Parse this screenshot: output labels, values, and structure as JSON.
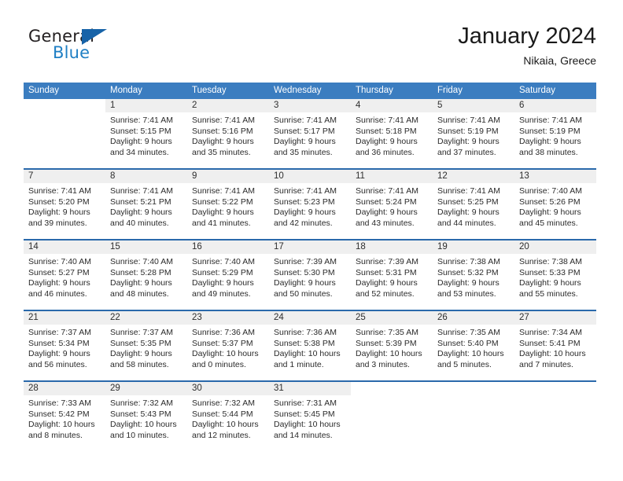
{
  "brand": {
    "name_top": "General",
    "name_bottom": "Blue",
    "accent_color": "#1763a8",
    "text_color": "#231f20",
    "blue_text_color": "#1f7fc4"
  },
  "header": {
    "title": "January 2024",
    "location": "Nikaia, Greece"
  },
  "theme": {
    "header_blue": "#3b7dc0",
    "row_divider_blue": "#2a69ab",
    "daynum_band_gray": "#efefef"
  },
  "weekdays": [
    "Sunday",
    "Monday",
    "Tuesday",
    "Wednesday",
    "Thursday",
    "Friday",
    "Saturday"
  ],
  "weeks": [
    [
      {
        "day": "",
        "lines": [],
        "filled": false
      },
      {
        "day": "1",
        "lines": [
          "Sunrise: 7:41 AM",
          "Sunset: 5:15 PM",
          "Daylight: 9 hours",
          "and 34 minutes."
        ],
        "filled": true
      },
      {
        "day": "2",
        "lines": [
          "Sunrise: 7:41 AM",
          "Sunset: 5:16 PM",
          "Daylight: 9 hours",
          "and 35 minutes."
        ],
        "filled": true
      },
      {
        "day": "3",
        "lines": [
          "Sunrise: 7:41 AM",
          "Sunset: 5:17 PM",
          "Daylight: 9 hours",
          "and 35 minutes."
        ],
        "filled": true
      },
      {
        "day": "4",
        "lines": [
          "Sunrise: 7:41 AM",
          "Sunset: 5:18 PM",
          "Daylight: 9 hours",
          "and 36 minutes."
        ],
        "filled": true
      },
      {
        "day": "5",
        "lines": [
          "Sunrise: 7:41 AM",
          "Sunset: 5:19 PM",
          "Daylight: 9 hours",
          "and 37 minutes."
        ],
        "filled": true
      },
      {
        "day": "6",
        "lines": [
          "Sunrise: 7:41 AM",
          "Sunset: 5:19 PM",
          "Daylight: 9 hours",
          "and 38 minutes."
        ],
        "filled": true
      }
    ],
    [
      {
        "day": "7",
        "lines": [
          "Sunrise: 7:41 AM",
          "Sunset: 5:20 PM",
          "Daylight: 9 hours",
          "and 39 minutes."
        ],
        "filled": true
      },
      {
        "day": "8",
        "lines": [
          "Sunrise: 7:41 AM",
          "Sunset: 5:21 PM",
          "Daylight: 9 hours",
          "and 40 minutes."
        ],
        "filled": true
      },
      {
        "day": "9",
        "lines": [
          "Sunrise: 7:41 AM",
          "Sunset: 5:22 PM",
          "Daylight: 9 hours",
          "and 41 minutes."
        ],
        "filled": true
      },
      {
        "day": "10",
        "lines": [
          "Sunrise: 7:41 AM",
          "Sunset: 5:23 PM",
          "Daylight: 9 hours",
          "and 42 minutes."
        ],
        "filled": true
      },
      {
        "day": "11",
        "lines": [
          "Sunrise: 7:41 AM",
          "Sunset: 5:24 PM",
          "Daylight: 9 hours",
          "and 43 minutes."
        ],
        "filled": true
      },
      {
        "day": "12",
        "lines": [
          "Sunrise: 7:41 AM",
          "Sunset: 5:25 PM",
          "Daylight: 9 hours",
          "and 44 minutes."
        ],
        "filled": true
      },
      {
        "day": "13",
        "lines": [
          "Sunrise: 7:40 AM",
          "Sunset: 5:26 PM",
          "Daylight: 9 hours",
          "and 45 minutes."
        ],
        "filled": true
      }
    ],
    [
      {
        "day": "14",
        "lines": [
          "Sunrise: 7:40 AM",
          "Sunset: 5:27 PM",
          "Daylight: 9 hours",
          "and 46 minutes."
        ],
        "filled": true
      },
      {
        "day": "15",
        "lines": [
          "Sunrise: 7:40 AM",
          "Sunset: 5:28 PM",
          "Daylight: 9 hours",
          "and 48 minutes."
        ],
        "filled": true
      },
      {
        "day": "16",
        "lines": [
          "Sunrise: 7:40 AM",
          "Sunset: 5:29 PM",
          "Daylight: 9 hours",
          "and 49 minutes."
        ],
        "filled": true
      },
      {
        "day": "17",
        "lines": [
          "Sunrise: 7:39 AM",
          "Sunset: 5:30 PM",
          "Daylight: 9 hours",
          "and 50 minutes."
        ],
        "filled": true
      },
      {
        "day": "18",
        "lines": [
          "Sunrise: 7:39 AM",
          "Sunset: 5:31 PM",
          "Daylight: 9 hours",
          "and 52 minutes."
        ],
        "filled": true
      },
      {
        "day": "19",
        "lines": [
          "Sunrise: 7:38 AM",
          "Sunset: 5:32 PM",
          "Daylight: 9 hours",
          "and 53 minutes."
        ],
        "filled": true
      },
      {
        "day": "20",
        "lines": [
          "Sunrise: 7:38 AM",
          "Sunset: 5:33 PM",
          "Daylight: 9 hours",
          "and 55 minutes."
        ],
        "filled": true
      }
    ],
    [
      {
        "day": "21",
        "lines": [
          "Sunrise: 7:37 AM",
          "Sunset: 5:34 PM",
          "Daylight: 9 hours",
          "and 56 minutes."
        ],
        "filled": true
      },
      {
        "day": "22",
        "lines": [
          "Sunrise: 7:37 AM",
          "Sunset: 5:35 PM",
          "Daylight: 9 hours",
          "and 58 minutes."
        ],
        "filled": true
      },
      {
        "day": "23",
        "lines": [
          "Sunrise: 7:36 AM",
          "Sunset: 5:37 PM",
          "Daylight: 10 hours",
          "and 0 minutes."
        ],
        "filled": true
      },
      {
        "day": "24",
        "lines": [
          "Sunrise: 7:36 AM",
          "Sunset: 5:38 PM",
          "Daylight: 10 hours",
          "and 1 minute."
        ],
        "filled": true
      },
      {
        "day": "25",
        "lines": [
          "Sunrise: 7:35 AM",
          "Sunset: 5:39 PM",
          "Daylight: 10 hours",
          "and 3 minutes."
        ],
        "filled": true
      },
      {
        "day": "26",
        "lines": [
          "Sunrise: 7:35 AM",
          "Sunset: 5:40 PM",
          "Daylight: 10 hours",
          "and 5 minutes."
        ],
        "filled": true
      },
      {
        "day": "27",
        "lines": [
          "Sunrise: 7:34 AM",
          "Sunset: 5:41 PM",
          "Daylight: 10 hours",
          "and 7 minutes."
        ],
        "filled": true
      }
    ],
    [
      {
        "day": "28",
        "lines": [
          "Sunrise: 7:33 AM",
          "Sunset: 5:42 PM",
          "Daylight: 10 hours",
          "and 8 minutes."
        ],
        "filled": true
      },
      {
        "day": "29",
        "lines": [
          "Sunrise: 7:32 AM",
          "Sunset: 5:43 PM",
          "Daylight: 10 hours",
          "and 10 minutes."
        ],
        "filled": true
      },
      {
        "day": "30",
        "lines": [
          "Sunrise: 7:32 AM",
          "Sunset: 5:44 PM",
          "Daylight: 10 hours",
          "and 12 minutes."
        ],
        "filled": true
      },
      {
        "day": "31",
        "lines": [
          "Sunrise: 7:31 AM",
          "Sunset: 5:45 PM",
          "Daylight: 10 hours",
          "and 14 minutes."
        ],
        "filled": true
      },
      {
        "day": "",
        "lines": [],
        "filled": false
      },
      {
        "day": "",
        "lines": [],
        "filled": false
      },
      {
        "day": "",
        "lines": [],
        "filled": false
      }
    ]
  ]
}
